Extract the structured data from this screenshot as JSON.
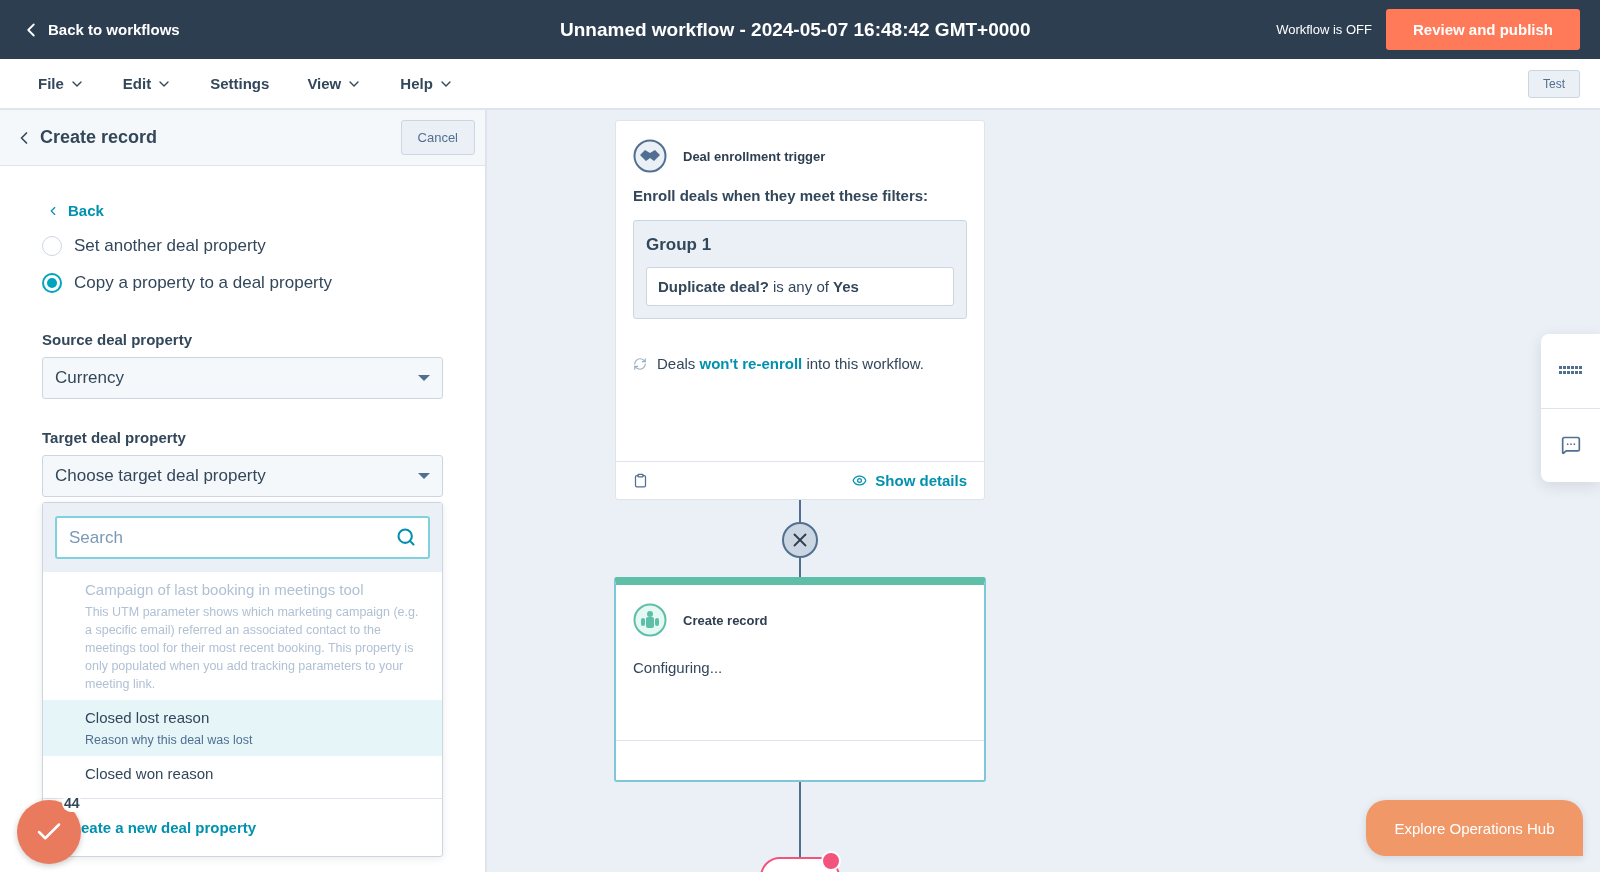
{
  "header": {
    "back_link": "Back to workflows",
    "title": "Unnamed workflow - 2024-05-07 16:48:42 GMT+0000",
    "status": "Workflow is OFF",
    "publish_button": "Review and publish"
  },
  "menu": {
    "items": [
      {
        "label": "File",
        "dropdown": true
      },
      {
        "label": "Edit",
        "dropdown": true
      },
      {
        "label": "Settings",
        "dropdown": false
      },
      {
        "label": "View",
        "dropdown": true
      },
      {
        "label": "Help",
        "dropdown": true
      }
    ],
    "test_button": "Test"
  },
  "panel": {
    "title": "Create record",
    "cancel_button": "Cancel",
    "back_link": "Back",
    "options": [
      {
        "label": "Set another deal property",
        "selected": false
      },
      {
        "label": "Copy a property to a deal property",
        "selected": true
      }
    ],
    "source": {
      "label": "Source deal property",
      "value": "Currency"
    },
    "target": {
      "label": "Target deal property",
      "placeholder": "Choose target deal property"
    },
    "dropdown": {
      "search_placeholder": "Search",
      "items": [
        {
          "title": "Campaign of last booking in meetings tool",
          "description": "This UTM parameter shows which marketing campaign (e.g. a specific email) referred an associated contact to the meetings tool for their most recent booking. This property is only populated when you add tracking parameters to your meeting link.",
          "disabled": true,
          "selected": false
        },
        {
          "title": "Closed lost reason",
          "description": "Reason why this deal was lost",
          "disabled": false,
          "selected": true
        },
        {
          "title": "Closed won reason",
          "disabled": false,
          "selected": false
        }
      ],
      "footer_link": "eate a new deal property"
    }
  },
  "task_badge": {
    "count": "44"
  },
  "canvas": {
    "trigger": {
      "title": "Deal enrollment trigger",
      "subtitle": "Enroll deals when they meet these filters:",
      "group_title": "Group 1",
      "filter": "**Duplicate deal?** is any of **Yes**",
      "reenroll": {
        "before": "Deals ",
        "link": "won't re-enroll",
        "after": " into this workflow."
      },
      "show_details": "Show details"
    },
    "action": {
      "title": "Create record",
      "status": "Configuring..."
    }
  },
  "explore_button": "Explore Operations Hub"
}
